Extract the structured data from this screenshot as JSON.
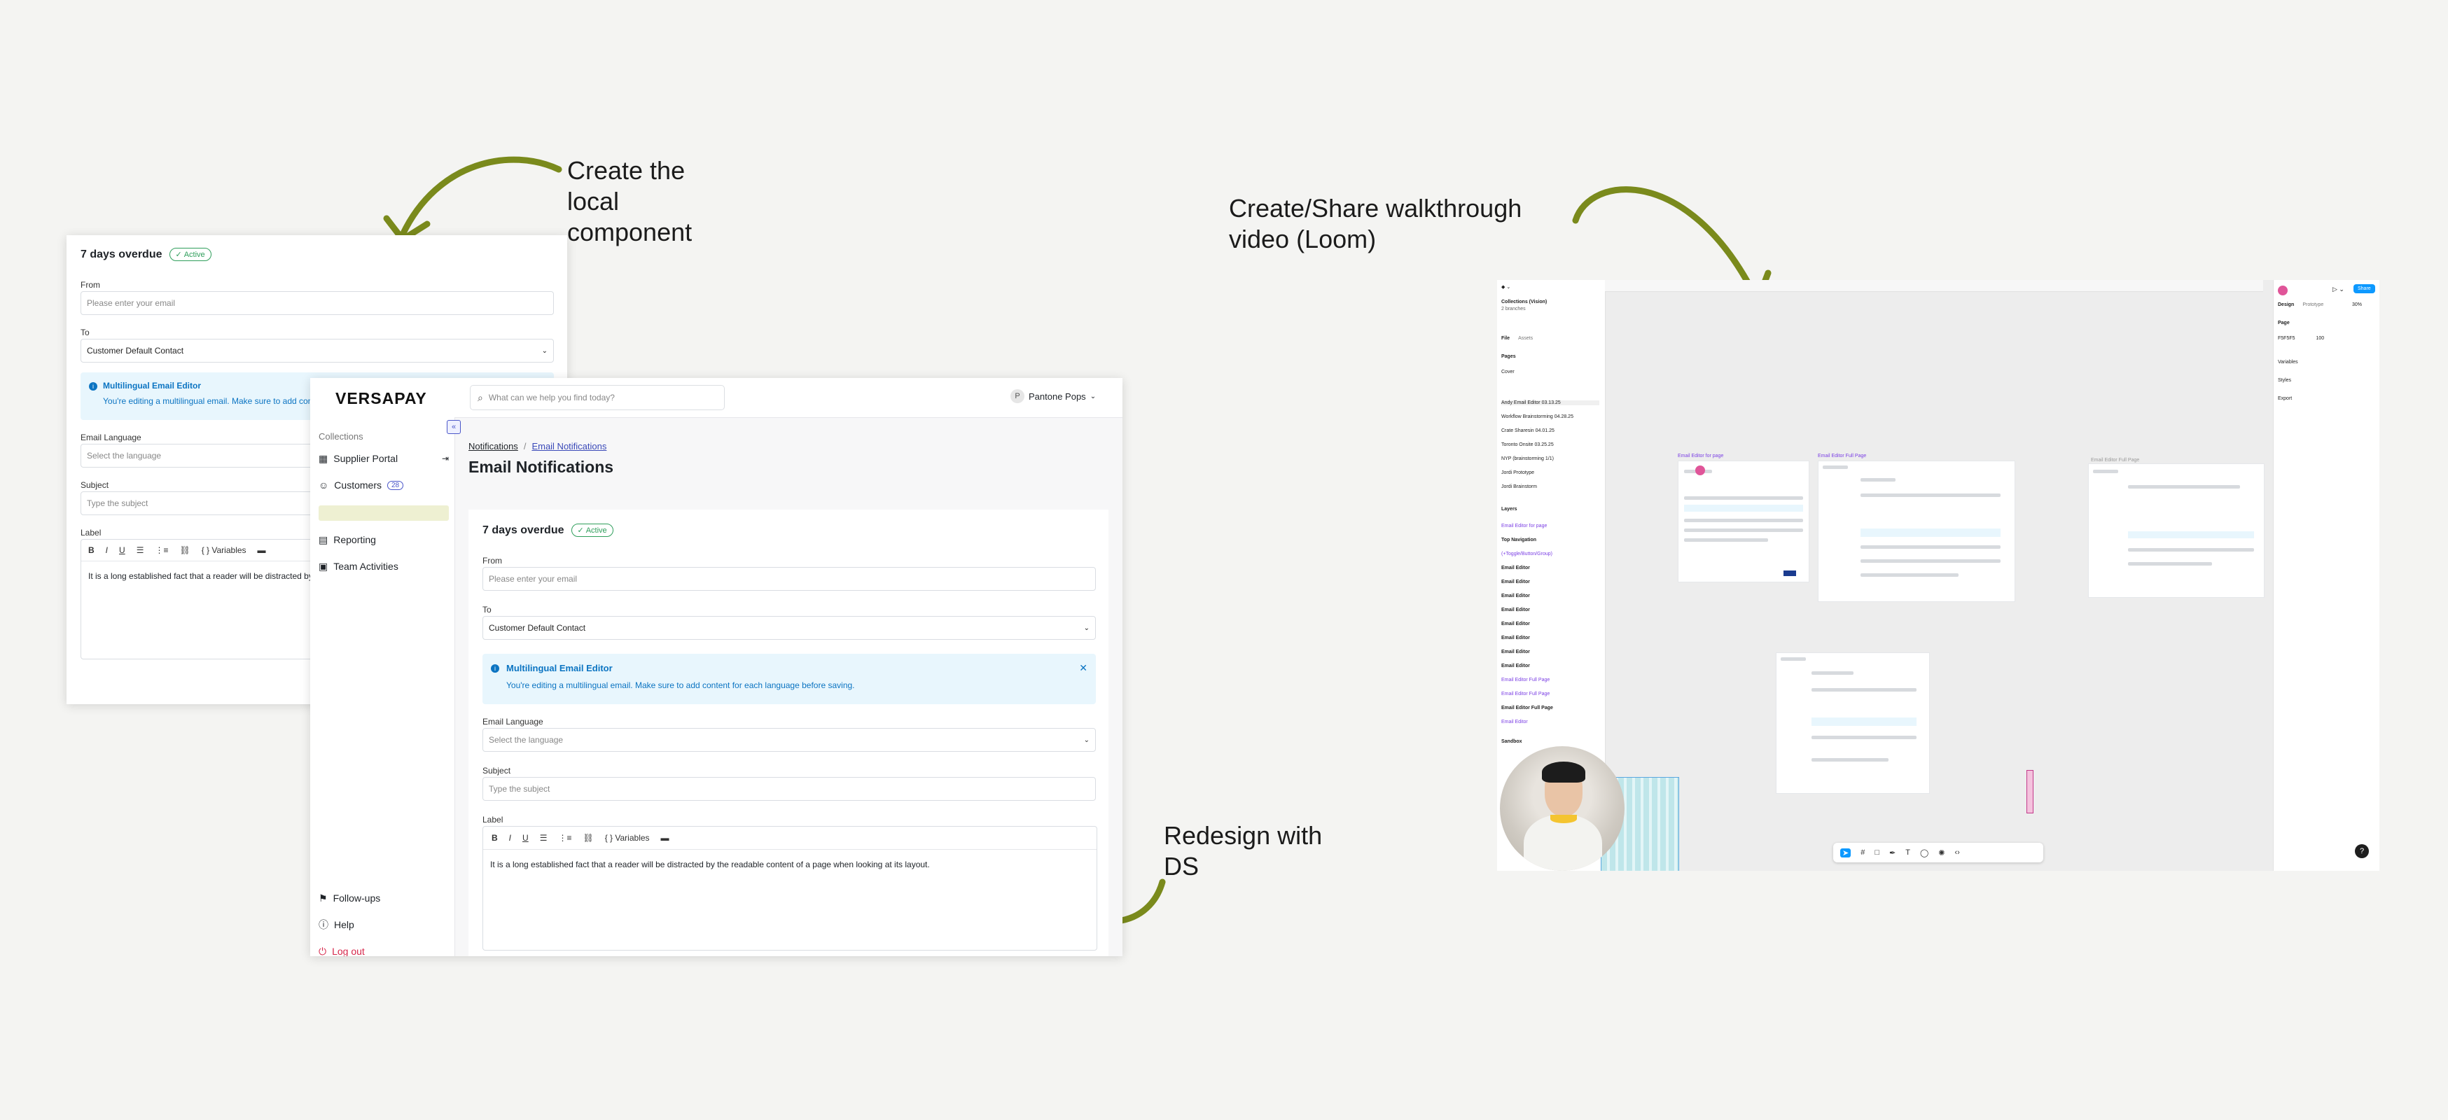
{
  "captions": {
    "local_component": "Create the\nlocal\ncomponent",
    "redesign": "Redesign with\nDS",
    "walkthrough": "Create/Share walkthrough\nvideo (Loom)"
  },
  "old_editor": {
    "title": "7 days overdue",
    "status": "Active",
    "from_label": "From",
    "from_placeholder": "Please enter your email",
    "to_label": "To",
    "to_value": "Customer Default Contact",
    "info_title": "Multilingual Email Editor",
    "info_text": "You're editing a multilingual email. Make sure to add conte",
    "language_label": "Email Language",
    "language_placeholder": "Select the language",
    "subject_label": "Subject",
    "subject_placeholder": "Type the subject",
    "body_label": "Label",
    "variables": "Variables",
    "body_text": "It is a long established fact that a reader will be distracted by th"
  },
  "app": {
    "brand": "VERSAPAY",
    "search_placeholder": "What can we help you find today?",
    "user_initial": "P",
    "user_name": "Pantone Pops",
    "sidebar": {
      "section": "Collections",
      "items": [
        {
          "label": "Supplier Portal"
        },
        {
          "label": "Customers",
          "badge": "28"
        },
        {
          "label": "Reporting"
        },
        {
          "label": "Team Activities"
        }
      ],
      "footer": [
        {
          "label": "Follow-ups"
        },
        {
          "label": "Help"
        },
        {
          "label": "Log out"
        }
      ]
    },
    "breadcrumb": [
      "Notifications",
      "Email Notifications"
    ],
    "page_title": "Email Notifications",
    "editor": {
      "title": "7 days overdue",
      "status": "Active",
      "from_label": "From",
      "from_placeholder": "Please enter your email",
      "to_label": "To",
      "to_value": "Customer Default Contact",
      "info_title": "Multilingual Email Editor",
      "info_text": "You're editing a multilingual email. Make sure to add content for each language before saving.",
      "language_label": "Email Language",
      "language_placeholder": "Select the language",
      "subject_label": "Subject",
      "subject_placeholder": "Type the subject",
      "body_label": "Label",
      "variables": "Variables",
      "body_text": "It is a long established fact that a reader will be distracted by the readable content of a page when looking at its layout."
    }
  },
  "figma": {
    "file_name": "Collections (Vision)",
    "branches": "2 branches",
    "tabs": [
      "File",
      "Assets"
    ],
    "pages_header": "Pages",
    "pages": [
      "Cover",
      "Andy Email Editor 03.13.25",
      "Workflow Brainstorming 04.28.25",
      "Crate Sharesin 04.01.25",
      "Toronto Onsite 03.25.25",
      "NYP (brainstorming 1/1)",
      "Jordi Prototype",
      "Jordi Brainstorm"
    ],
    "layers_header": "Layers",
    "layers": [
      "Email Editor for page",
      "Top Navigation",
      "(+Toggle/Button/Group)",
      "Email Editor",
      "Email Editor",
      "Email Editor",
      "Email Editor",
      "Email Editor",
      "Email Editor",
      "Email Editor",
      "Email Editor",
      "Email Editor Full Page",
      "Email Editor Full Page",
      "Email Editor Full Page",
      "Email Editor",
      "Sandbox"
    ],
    "right_tabs": [
      "Design",
      "Prototype"
    ],
    "zoom": "30%",
    "share": "Share",
    "page_label": "Page",
    "page_color": "F5F5F5",
    "page_opacity": "100",
    "sections": [
      "Variables",
      "Styles",
      "Export"
    ],
    "frame_titles": [
      "Email Editor for page",
      "Email Editor Full Page",
      "Email Editor Full Page"
    ],
    "help": "?"
  },
  "colors": {
    "accent_green": "#2f9e5b",
    "info_blue": "#0b74c2",
    "logout_red": "#d6264a",
    "arrow_olive": "#7a8a1c",
    "figma_blue": "#0d99ff"
  }
}
